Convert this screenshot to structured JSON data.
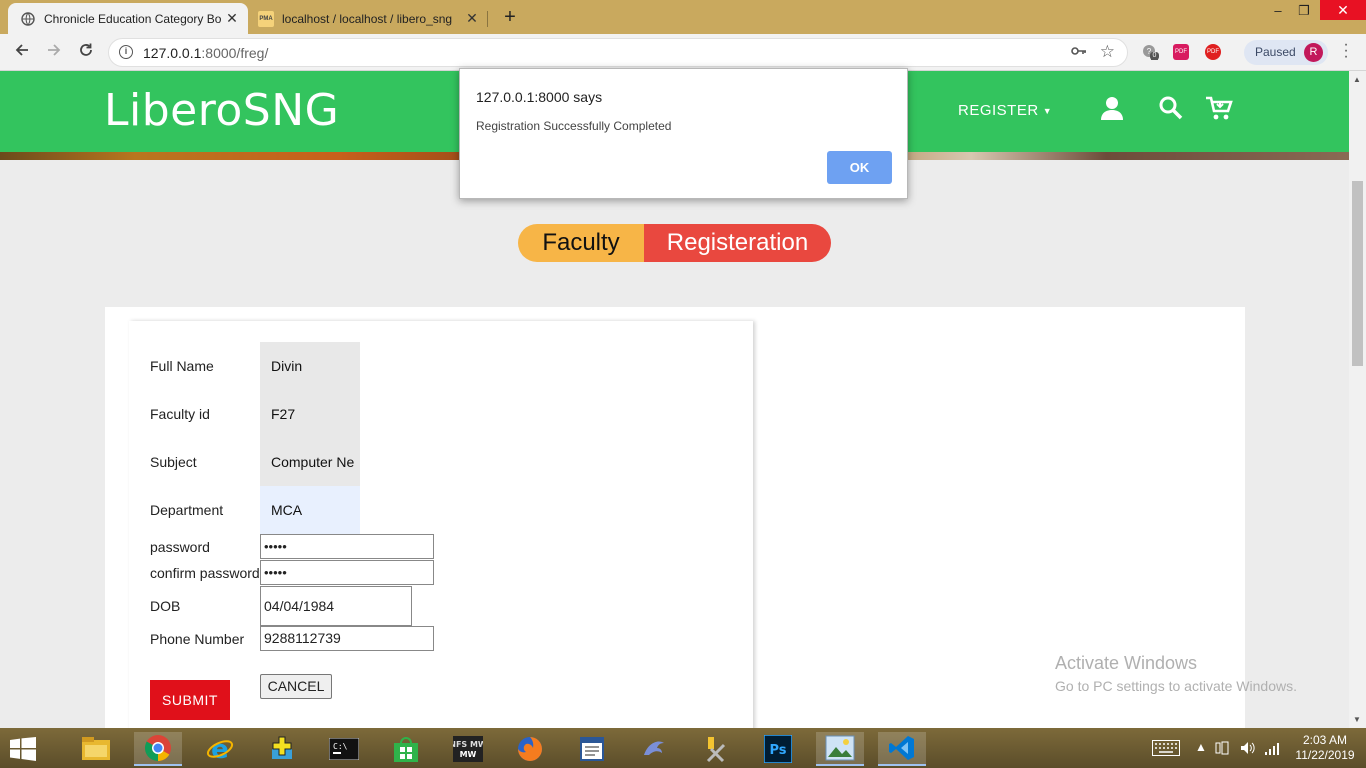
{
  "browser": {
    "tabs": [
      {
        "title": "Chronicle Education Category Bo",
        "active": true
      },
      {
        "title": "localhost / localhost / libero_sng",
        "favicon_text": "PMA",
        "active": false
      }
    ],
    "new_tab": "+",
    "window_controls": {
      "minimize": "–",
      "maximize": "❐",
      "close": "✕"
    },
    "url_host": "127.0.0.1",
    "url_rest": ":8000/freg/",
    "profile_status": "Paused",
    "profile_initial": "R",
    "extensions": [
      {
        "label": "0",
        "color": "#8a8a8a"
      },
      {
        "label": "PDF",
        "color": "#d81b60"
      },
      {
        "label": "PDF",
        "color": "#e02020"
      }
    ]
  },
  "site": {
    "logo": "LiberoSNG",
    "nav_register": "REGISTER",
    "colors": {
      "header": "#33c45e",
      "pill_left": "#f7b547",
      "pill_right": "#e9483f",
      "submit": "#e0101a"
    }
  },
  "page_title": {
    "left": "Faculty",
    "right": "Registeration"
  },
  "form": {
    "labels": {
      "full_name": "Full Name",
      "faculty_id": "Faculty id",
      "subject": "Subject",
      "department": "Department",
      "password": "password",
      "confirm_password": "confirm password",
      "dob": "DOB",
      "phone": "Phone Number"
    },
    "values": {
      "full_name": "Divin",
      "faculty_id": "F27",
      "subject": "Computer Ne",
      "department": "MCA",
      "password": "•••••",
      "confirm_password": "•••••",
      "dob": "04/04/1984",
      "phone": "9288112739"
    },
    "submit_label": "SUBMIT",
    "cancel_label": "CANCEL"
  },
  "dialog": {
    "origin": "127.0.0.1:8000 says",
    "message": "Registration Successfully Completed",
    "ok_label": "OK"
  },
  "watermark": {
    "line1": "Activate Windows",
    "line2": "Go to PC settings to activate Windows."
  },
  "taskbar": {
    "apps": [
      "file-explorer",
      "chrome",
      "internet-explorer",
      "installer",
      "command-prompt",
      "store",
      "nfs-mw",
      "firefox",
      "notepad",
      "dolphin",
      "tools",
      "photoshop",
      "photo-viewer",
      "vscode"
    ],
    "ps_label": "Ps",
    "nfs_label": "NFS MW",
    "time": "2:03 AM",
    "date": "11/22/2019"
  }
}
